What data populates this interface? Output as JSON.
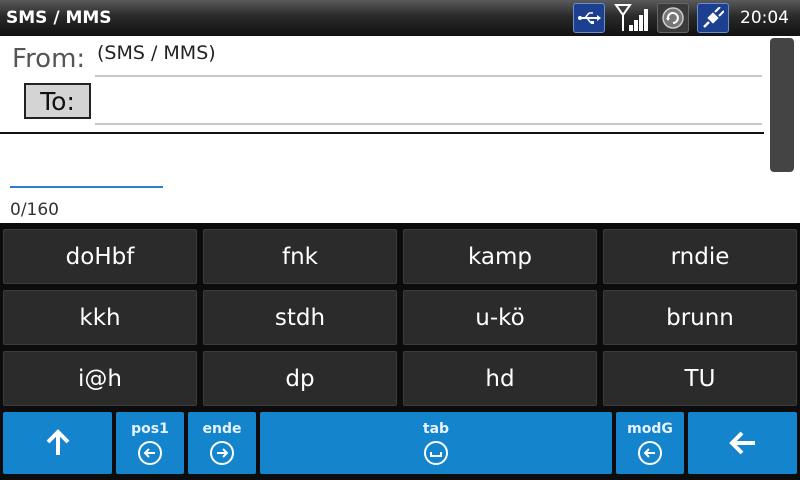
{
  "statusbar": {
    "title": "SMS / MMS",
    "time": "20:04",
    "icons": [
      "usb-icon",
      "signal-icon",
      "sync-icon",
      "power-icon"
    ]
  },
  "compose": {
    "from_label": "From:",
    "from_value": "(SMS / MMS)",
    "to_button_label": "To:",
    "to_value": "",
    "body_value": "",
    "char_count": "0/160"
  },
  "keyboard": {
    "rows": [
      [
        "doHbf",
        "fnk",
        "kamp",
        "rndie"
      ],
      [
        "kkh",
        "stdh",
        "u-kö",
        "brunn"
      ],
      [
        "i@h",
        "dp",
        "hd",
        "TU"
      ]
    ],
    "bottom": {
      "pos1_label": "pos1",
      "ende_label": "ende",
      "tab_label": "tab",
      "modg_label": "modG"
    }
  },
  "colors": {
    "accent": "#1484cc",
    "key_bg": "#2b2b2b",
    "keyboard_bg": "#0c0c0c"
  }
}
